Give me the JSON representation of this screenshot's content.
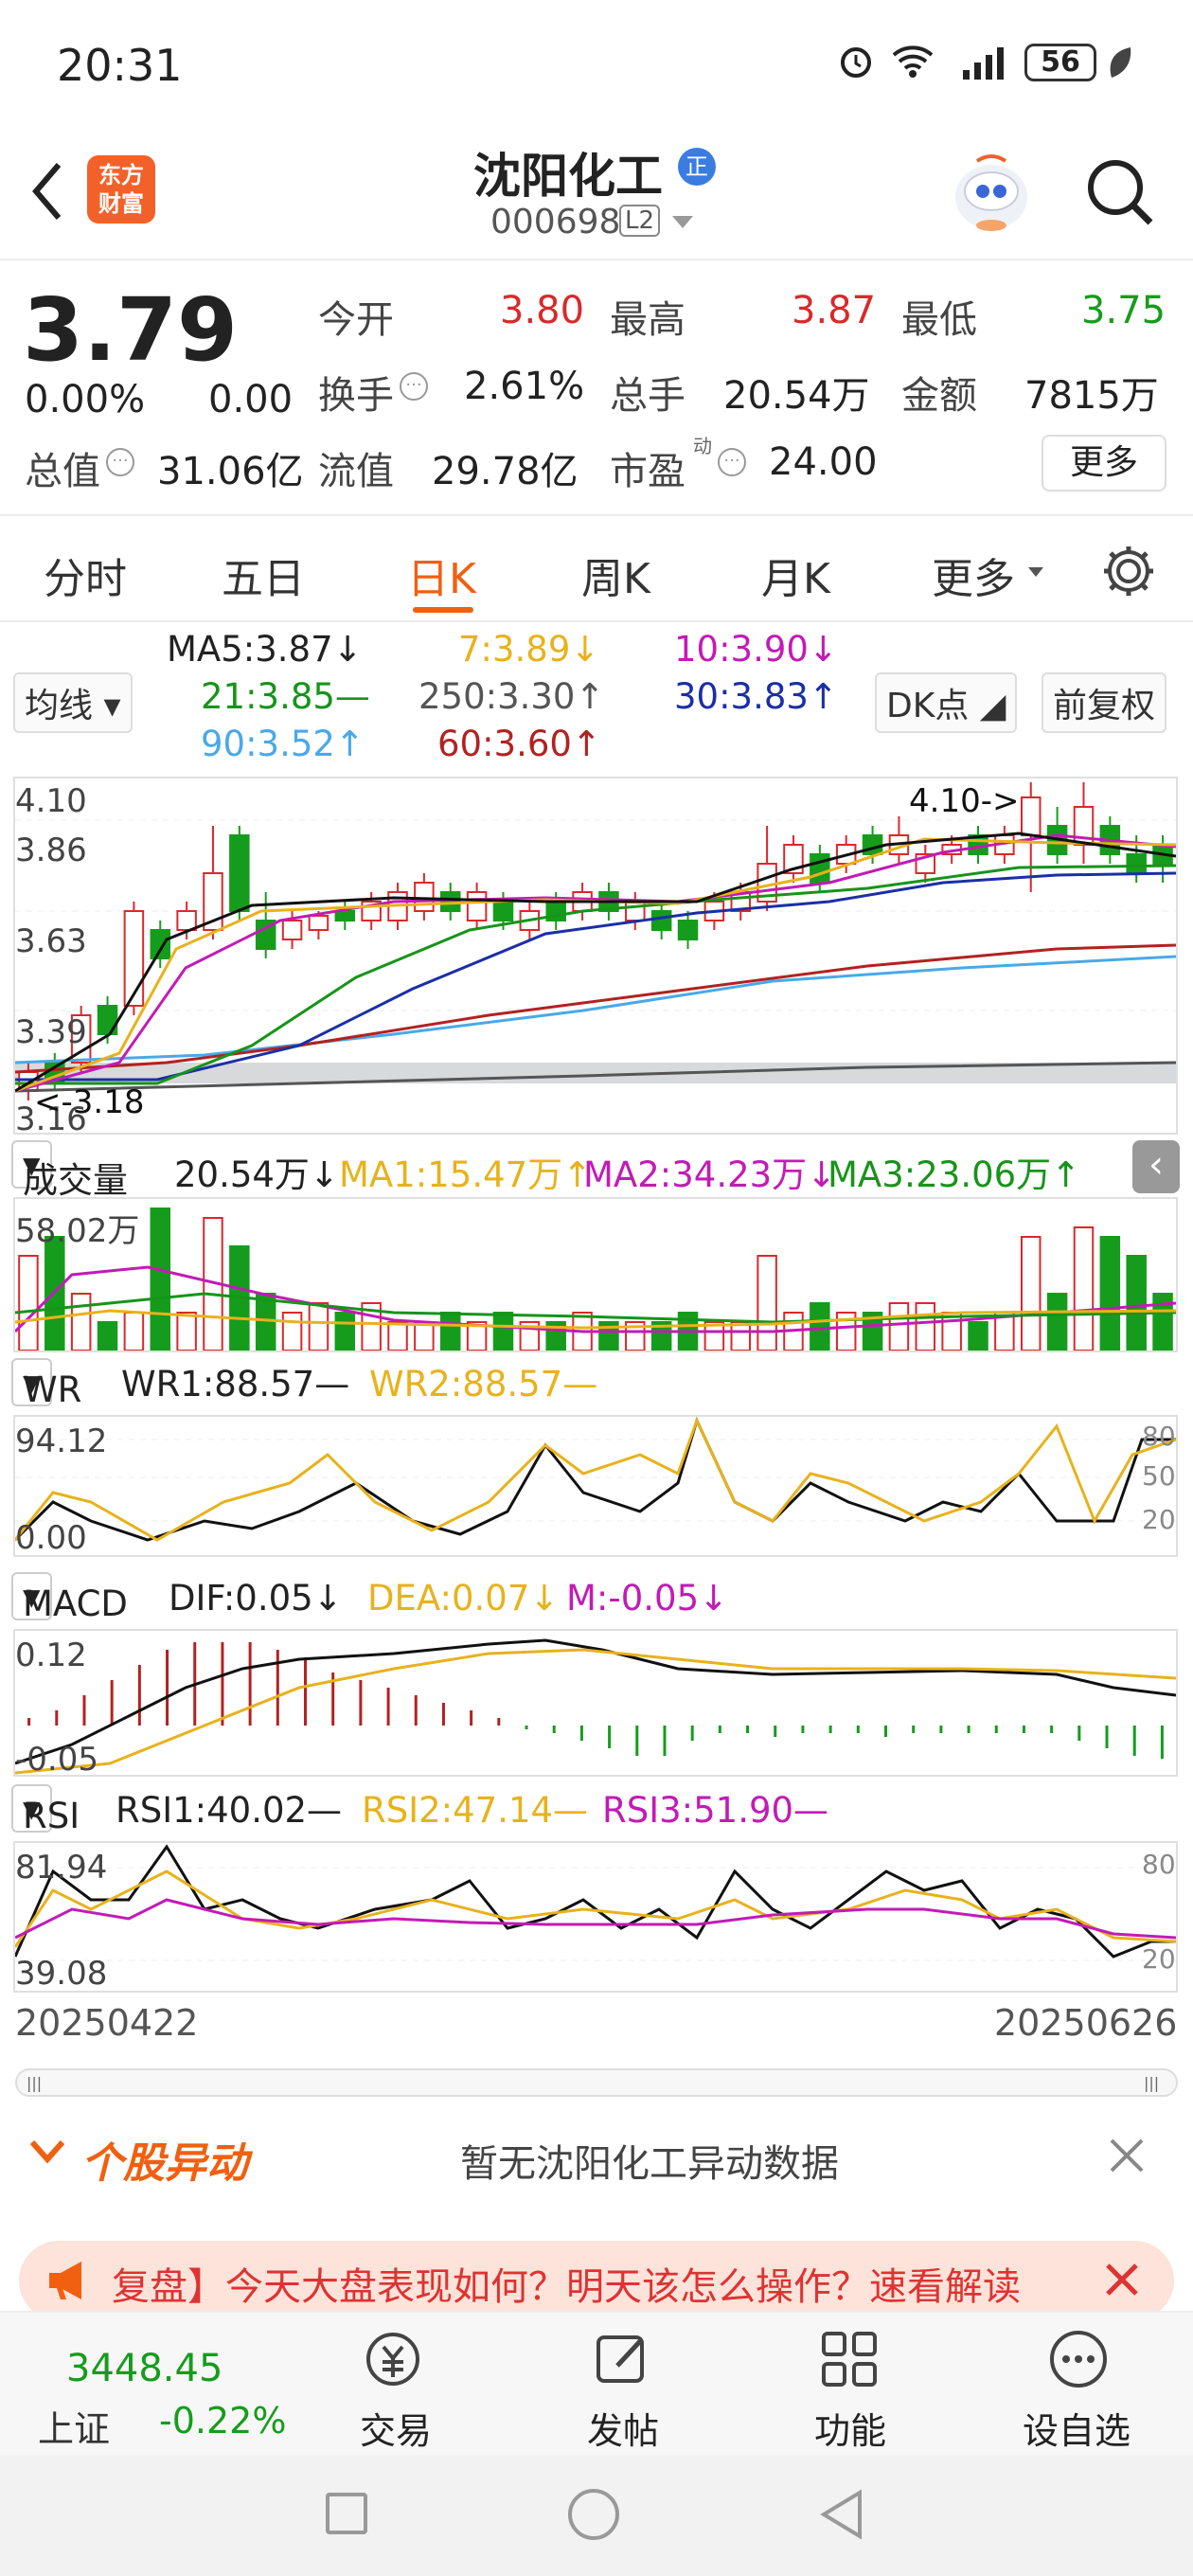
{
  "status": {
    "time": "20:31",
    "battery": "56"
  },
  "header": {
    "app_badge": "东方\n财富",
    "stock_name": "沈阳化工",
    "name_badge": "正",
    "code": "000698",
    "level": "L2"
  },
  "quote": {
    "price": "3.79",
    "change_pct": "0.00%",
    "change": "0.00",
    "open_label": "今开",
    "open": "3.80",
    "high_label": "最高",
    "high": "3.87",
    "low_label": "最低",
    "low": "3.75",
    "turnover_label": "换手",
    "turnover": "2.61%",
    "volume_label": "总手",
    "volume": "20.54万",
    "amount_label": "金额",
    "amount": "7815万",
    "mcap_label": "总值",
    "mcap": "31.06亿",
    "float_label": "流值",
    "float": "29.78亿",
    "pe_label": "市盈",
    "pe_sup": "动",
    "pe": "24.00",
    "more": "更多"
  },
  "tabs": [
    "分时",
    "五日",
    "日K",
    "周K",
    "月K",
    "更多"
  ],
  "ma": {
    "select": "均线",
    "ma5": "MA5:3.87↓",
    "ma7": "7:3.89↓",
    "ma10": "10:3.90↓",
    "ma21": "21:3.85—",
    "ma250": "250:3.30↑",
    "ma30": "30:3.83↑",
    "ma90": "90:3.52↑",
    "ma60": "60:3.60↑",
    "dk": "DK点",
    "fq": "前复权"
  },
  "kline": {
    "y_labels": [
      "4.10",
      "3.86",
      "3.63",
      "3.39",
      "3.16"
    ],
    "max_marker": "4.10->",
    "min_marker": "<-3.18"
  },
  "vol": {
    "select": "成交量",
    "value": "20.54万↓",
    "ma1": "MA1:15.47万↑",
    "ma2": "MA2:34.23万↓",
    "ma3": "MA3:23.06万↑",
    "top": "58.02万"
  },
  "wr": {
    "select": "WR",
    "wr1": "WR1:88.57—",
    "wr2": "WR2:88.57—",
    "top": "94.12",
    "bottom": "0.00",
    "r80": "80",
    "r50": "50",
    "r20": "20"
  },
  "macd": {
    "select": "MACD",
    "dif": "DIF:0.05↓",
    "dea": "DEA:0.07↓",
    "m": "M:-0.05↓",
    "top": "0.12",
    "bottom": "-0.05"
  },
  "rsi": {
    "select": "RSI",
    "rsi1": "RSI1:40.02—",
    "rsi2": "RSI2:47.14—",
    "rsi3": "RSI3:51.90—",
    "top": "81.94",
    "bottom": "39.08",
    "r80": "80",
    "r20": "20"
  },
  "dates": {
    "start": "20250422",
    "end": "20250626"
  },
  "alert": {
    "title": "个股异动",
    "message": "暂无沈阳化工异动数据"
  },
  "banner": {
    "text": "复盘】今天大盘表现如何？明天该怎么操作？速看解读"
  },
  "bottom_nav": {
    "index_value": "3448.45",
    "index_name": "上证",
    "index_change": "-0.22%",
    "trade": "交易",
    "post": "发帖",
    "func": "功能",
    "watch": "设自选"
  }
}
